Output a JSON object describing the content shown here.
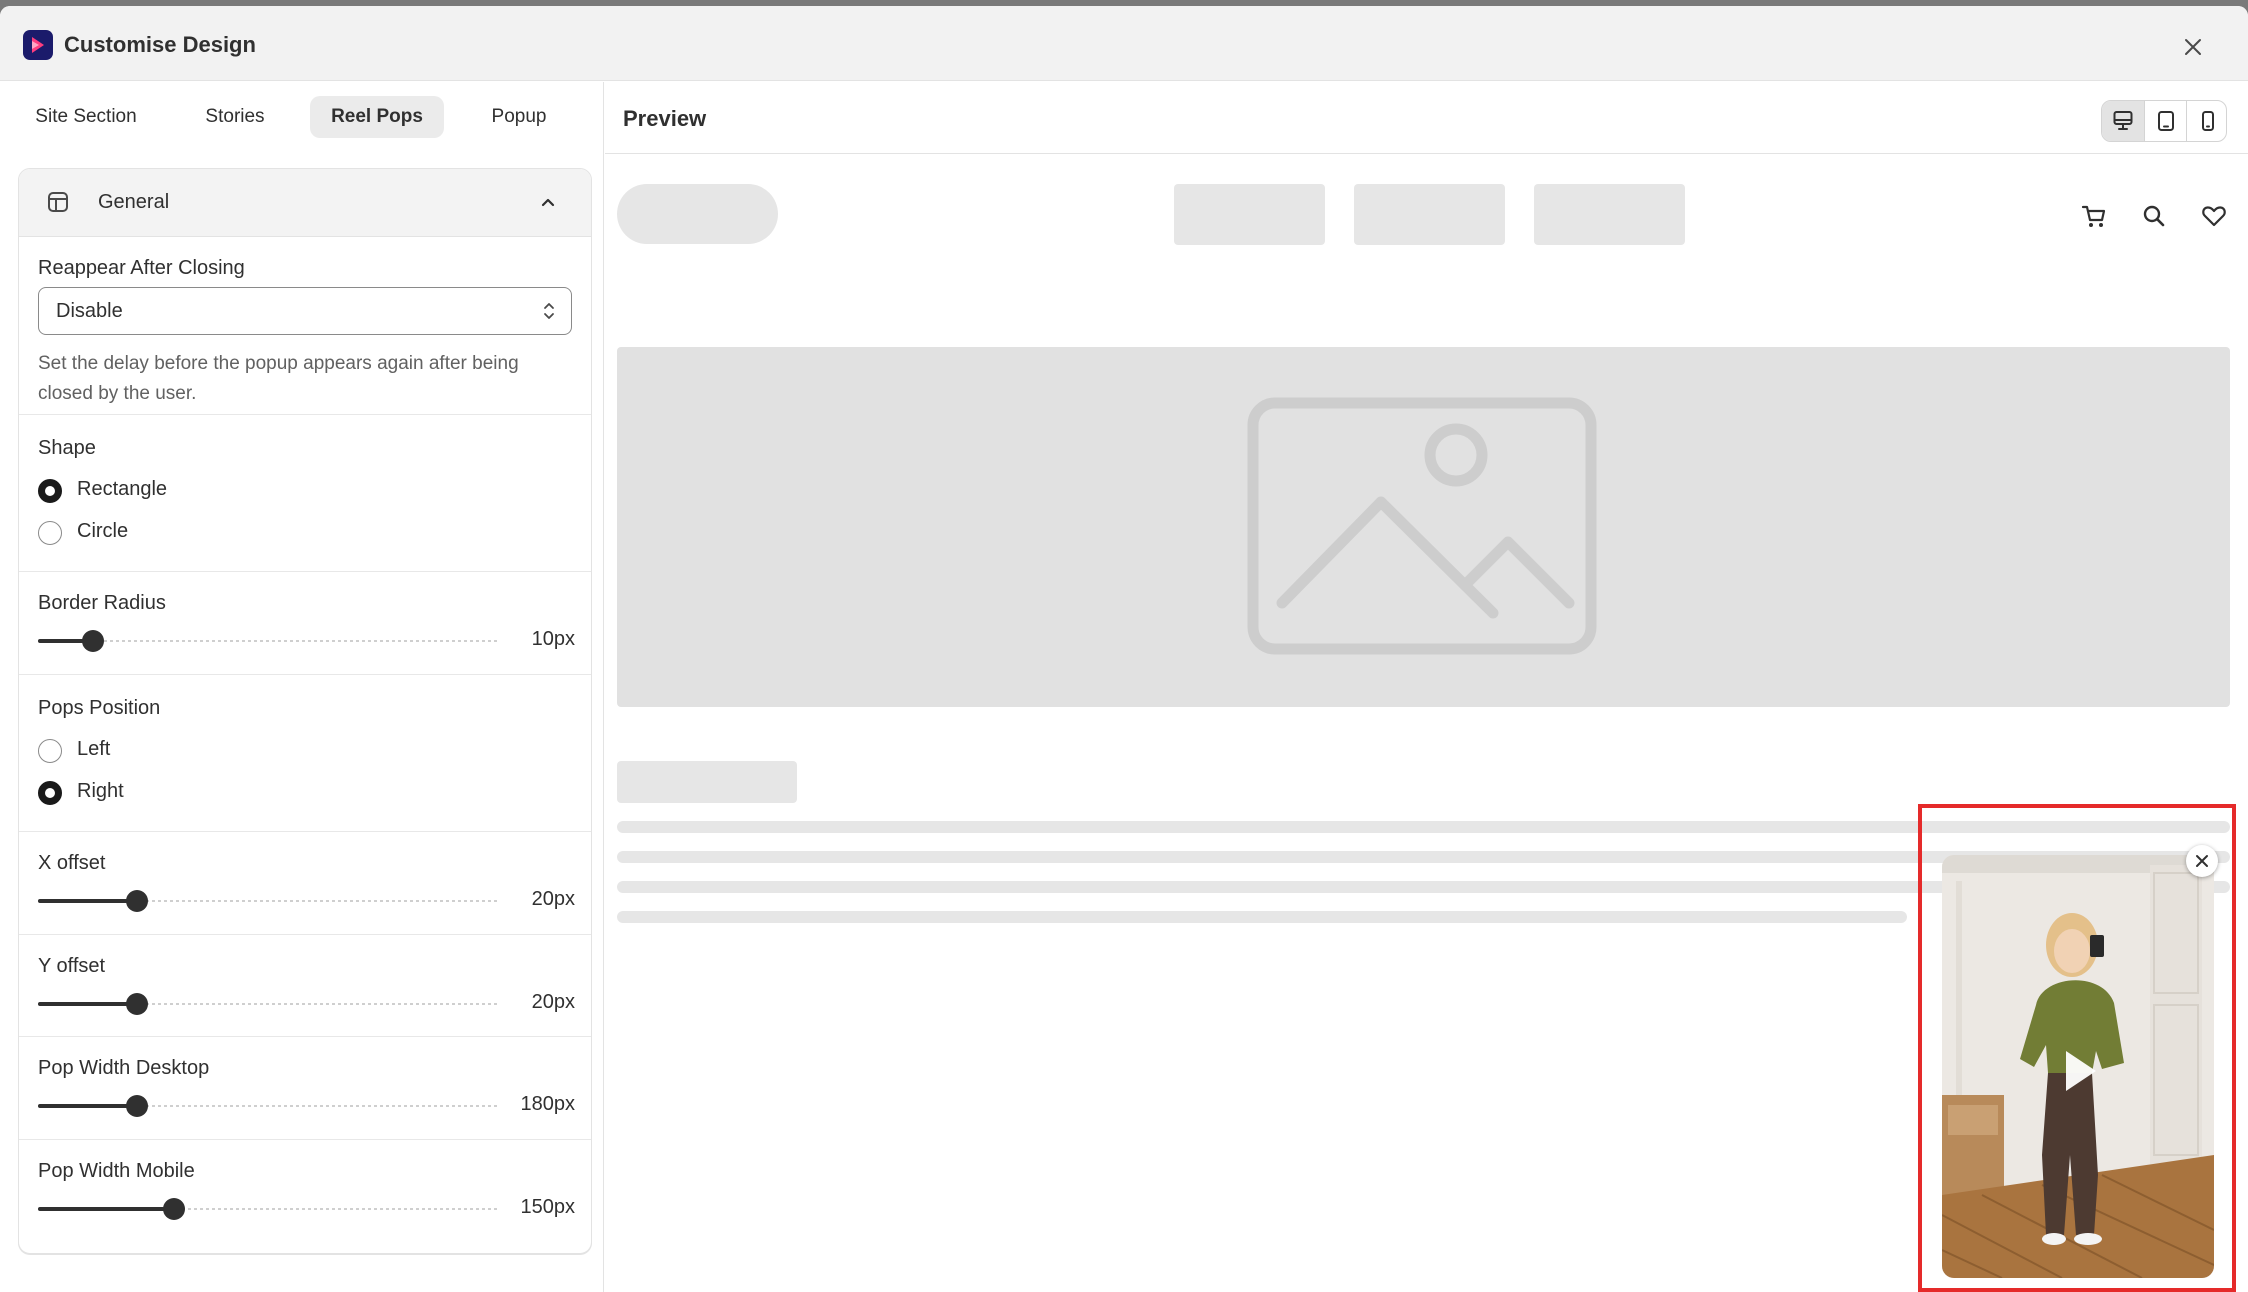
{
  "window": {
    "title": "Customise Design"
  },
  "tabs": [
    {
      "label": "Site Section"
    },
    {
      "label": "Stories"
    },
    {
      "label": "Reel Pops",
      "active": true
    },
    {
      "label": "Popup"
    }
  ],
  "general": {
    "header_label": "General",
    "reappear": {
      "label": "Reappear After Closing",
      "value": "Disable",
      "help": "Set the delay before the popup appears again after being closed by the user."
    },
    "shape": {
      "label": "Shape",
      "options": [
        {
          "label": "Rectangle",
          "checked": true
        },
        {
          "label": "Circle",
          "checked": false
        }
      ]
    },
    "border_radius": {
      "label": "Border Radius",
      "value": "10px",
      "fraction": 0.12
    },
    "pops_position": {
      "label": "Pops Position",
      "options": [
        {
          "label": "Left",
          "checked": false
        },
        {
          "label": "Right",
          "checked": true
        }
      ]
    },
    "x_offset": {
      "label": "X offset",
      "value": "20px",
      "fraction": 0.215
    },
    "y_offset": {
      "label": "Y offset",
      "value": "20px",
      "fraction": 0.215
    },
    "pop_width_desktop": {
      "label": "Pop Width Desktop",
      "value": "180px",
      "fraction": 0.215
    },
    "pop_width_mobile": {
      "label": "Pop Width Mobile",
      "value": "150px",
      "fraction": 0.295
    }
  },
  "preview": {
    "title": "Preview",
    "devices": [
      "desktop-icon",
      "tablet-icon",
      "mobile-icon"
    ],
    "active_device": "desktop"
  },
  "colors": {
    "highlight": "#e52a2a",
    "placeholder": "#e6e6e6",
    "text": "#303030"
  }
}
